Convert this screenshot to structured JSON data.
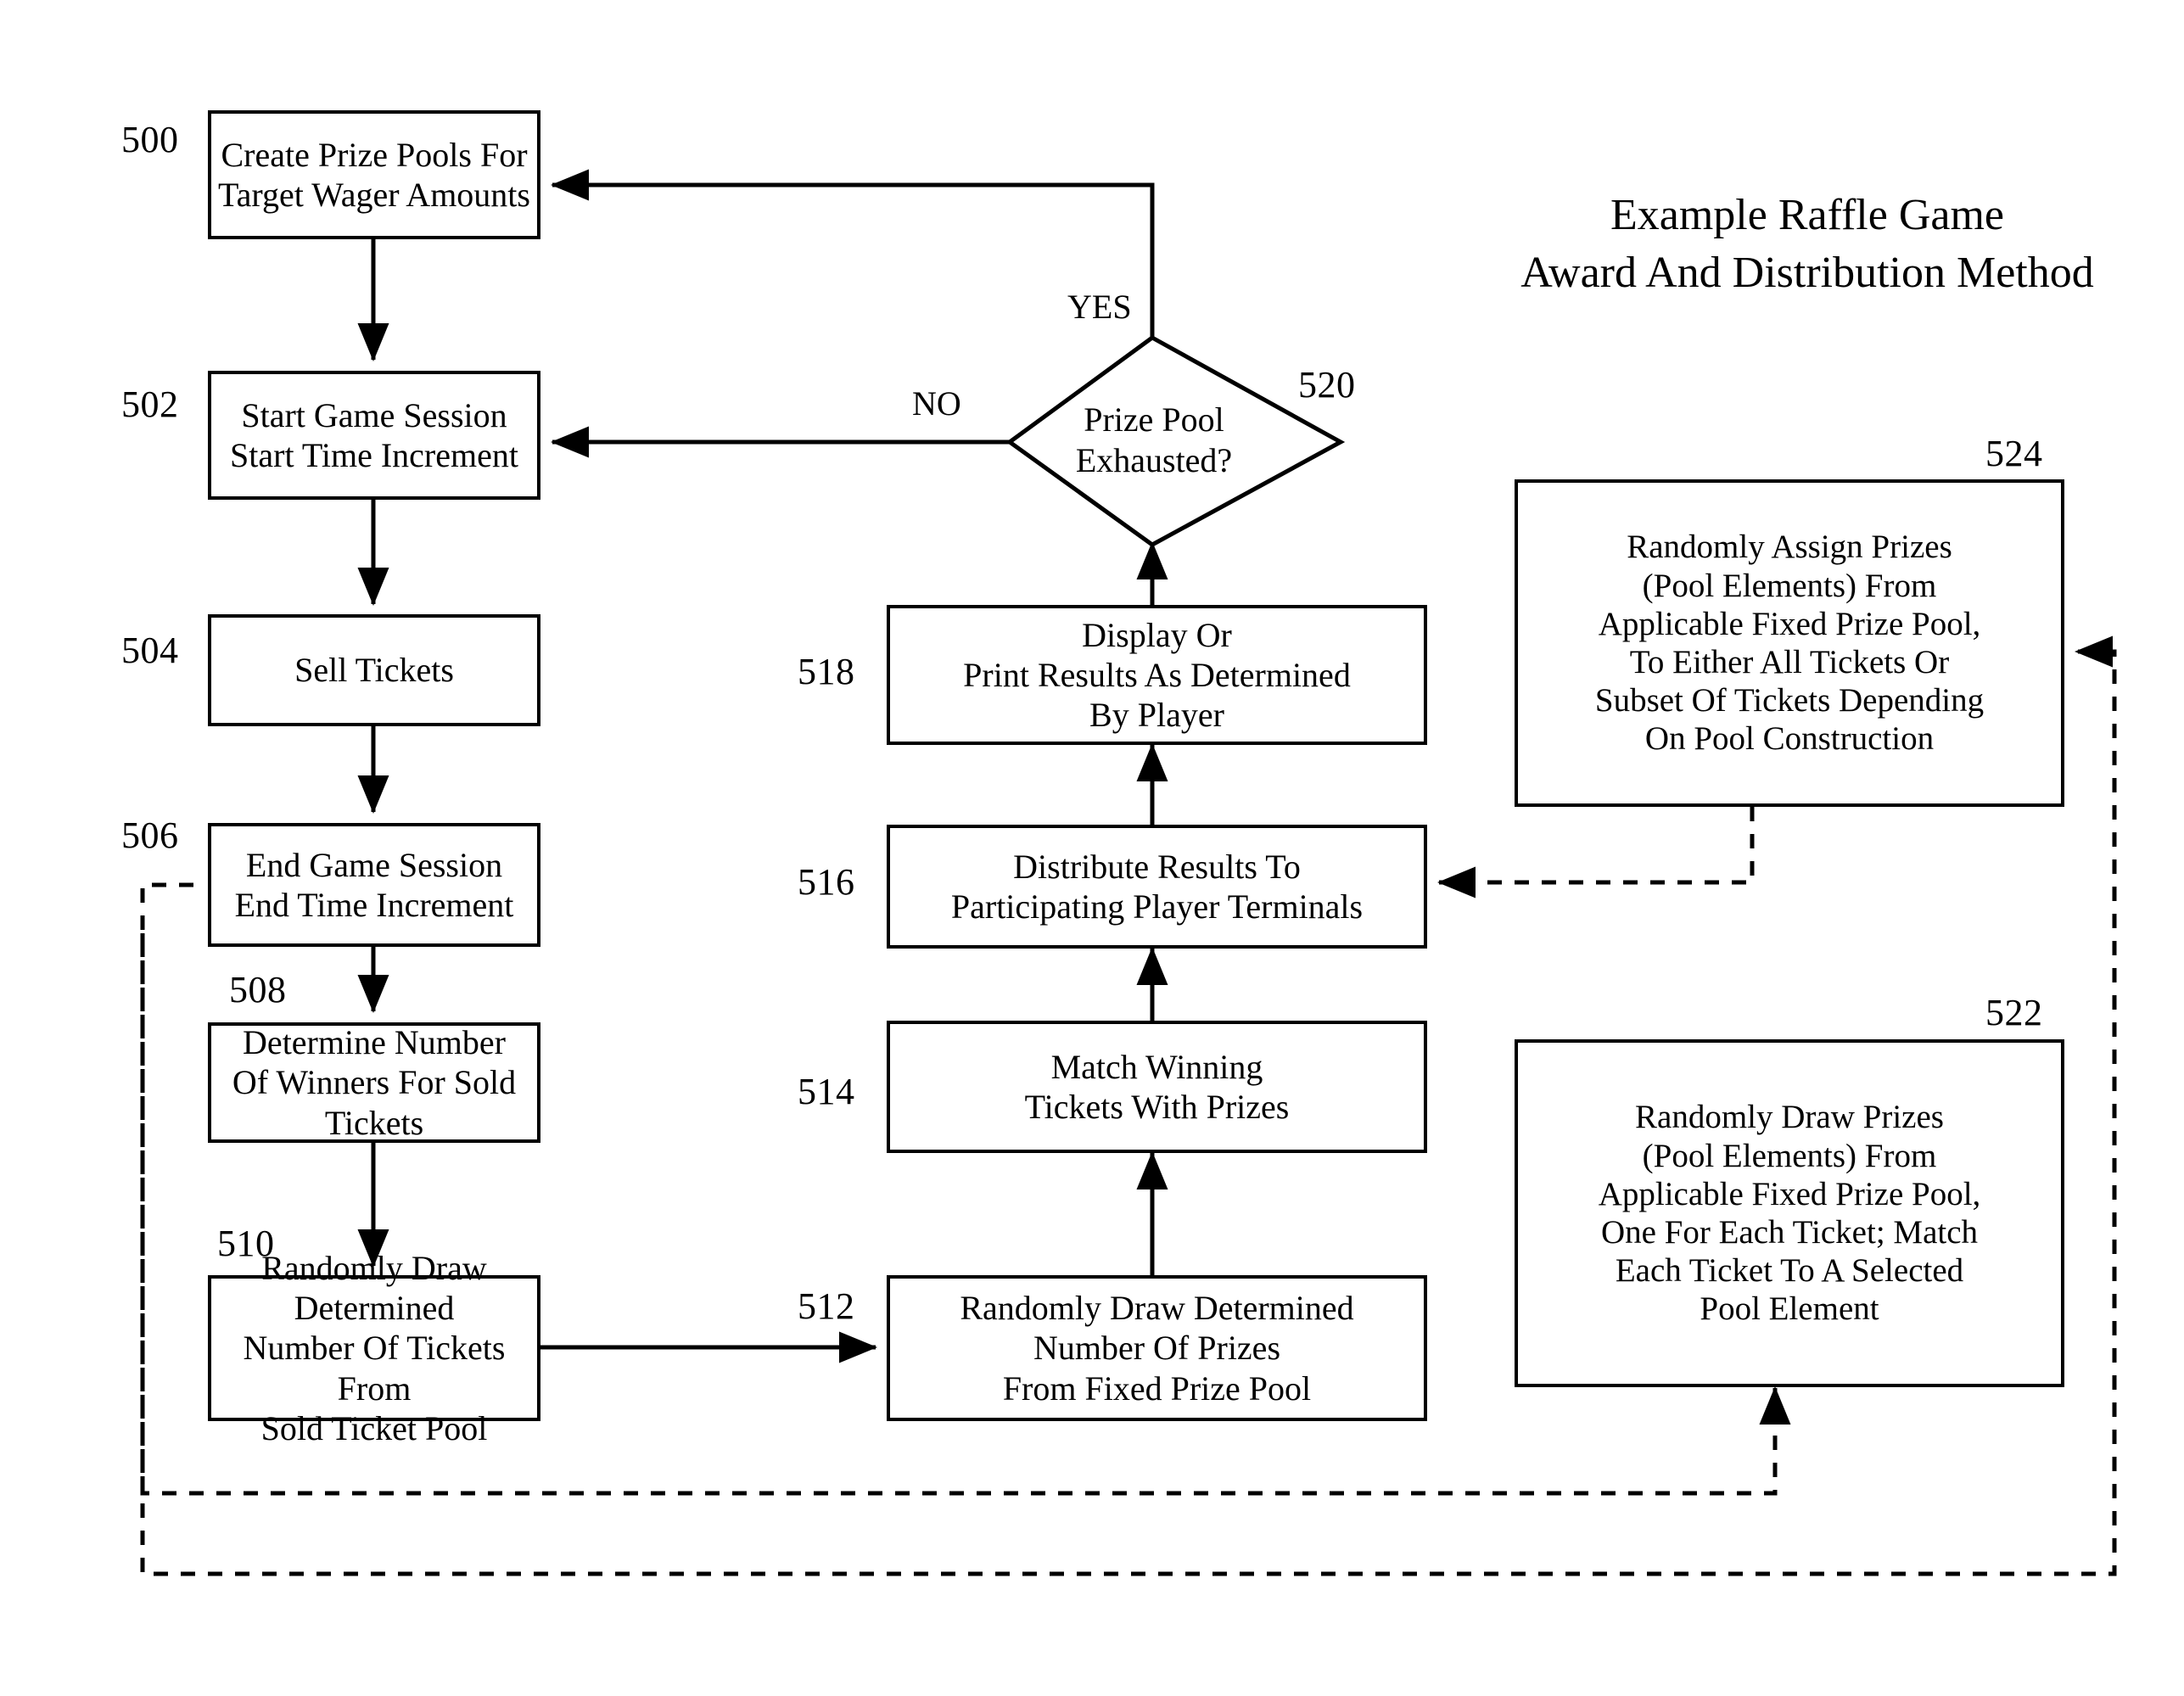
{
  "figure": {
    "title": "Example Raffle Game\nAward And Distribution Method",
    "kind": "flowchart"
  },
  "nodes": {
    "n500": {
      "ref": "500",
      "text": "Create Prize Pools For\nTarget Wager Amounts"
    },
    "n502": {
      "ref": "502",
      "text": "Start Game Session\nStart Time Increment"
    },
    "n504": {
      "ref": "504",
      "text": "Sell Tickets"
    },
    "n506": {
      "ref": "506",
      "text": "End Game Session\nEnd Time Increment"
    },
    "n508": {
      "ref": "508",
      "text": "Determine Number\nOf Winners For Sold Tickets"
    },
    "n510": {
      "ref": "510",
      "text": "Randomly Draw Determined\nNumber Of Tickets From\nSold Ticket Pool"
    },
    "n512": {
      "ref": "512",
      "text": "Randomly Draw Determined\nNumber Of Prizes\nFrom Fixed Prize Pool"
    },
    "n514": {
      "ref": "514",
      "text": "Match Winning\nTickets With Prizes"
    },
    "n516": {
      "ref": "516",
      "text": "Distribute Results To\nParticipating Player Terminals"
    },
    "n518": {
      "ref": "518",
      "text": "Display Or\nPrint Results As Determined\nBy Player"
    },
    "n520": {
      "ref": "520",
      "text": "Prize Pool\nExhausted?"
    },
    "n522": {
      "ref": "522",
      "text": "Randomly Draw Prizes\n(Pool Elements) From\nApplicable Fixed Prize Pool,\nOne For Each Ticket; Match\nEach Ticket To A Selected\nPool Element"
    },
    "n524": {
      "ref": "524",
      "text": "Randomly Assign Prizes\n(Pool Elements) From\nApplicable Fixed Prize Pool,\nTo Either All Tickets Or\nSubset Of Tickets Depending\nOn Pool Construction"
    }
  },
  "edge_labels": {
    "yes": "YES",
    "no": "NO"
  },
  "colors": {
    "stroke": "#000000",
    "background": "#ffffff"
  }
}
